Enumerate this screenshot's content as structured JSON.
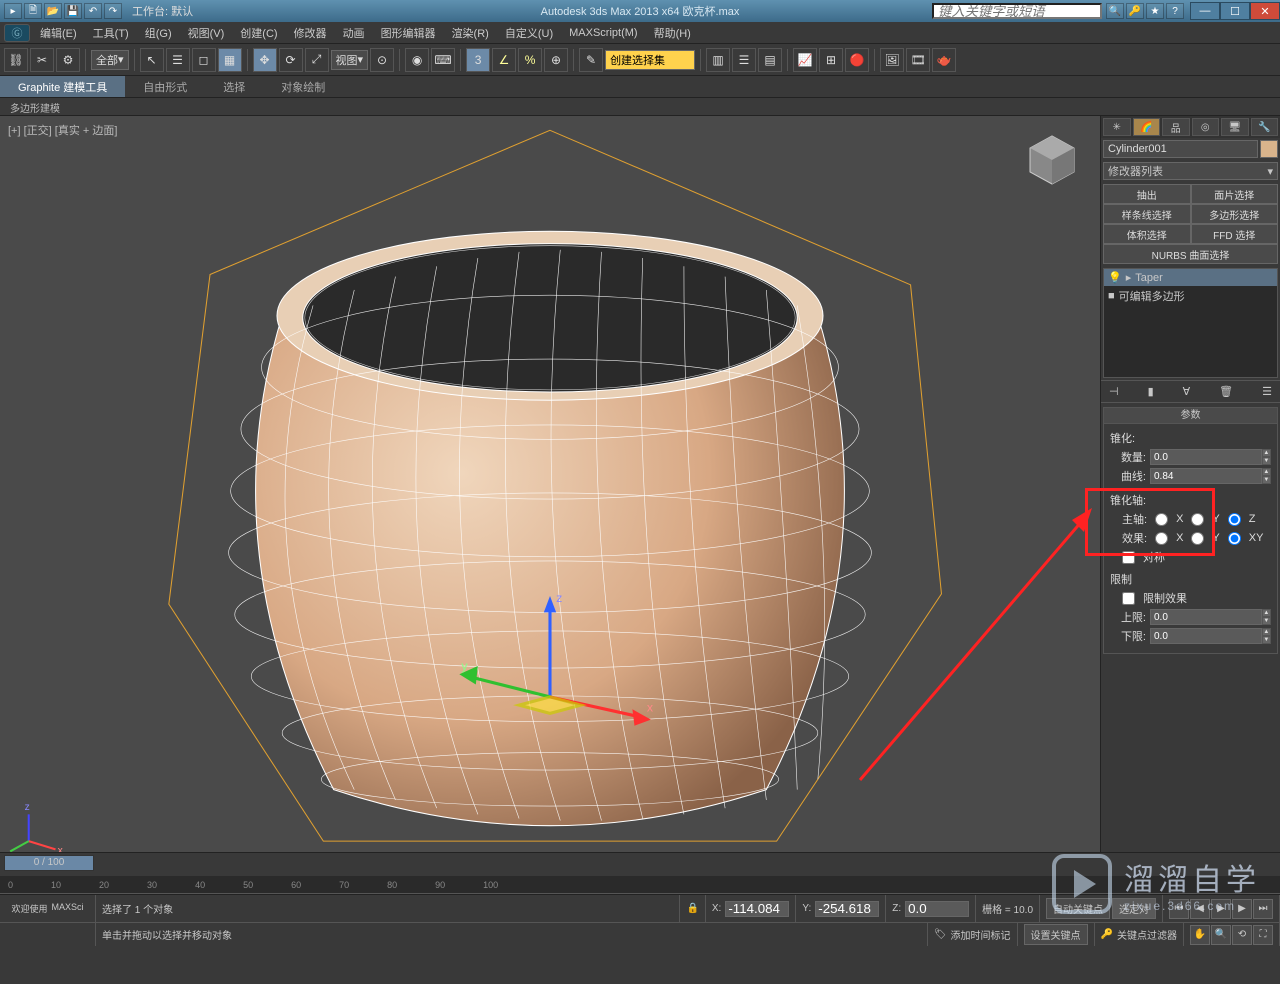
{
  "titlebar": {
    "workspace_label": "工作台: 默认",
    "app_title": "Autodesk 3ds Max  2013 x64   欧克杯.max",
    "search_placeholder": "键入关键字或短语"
  },
  "menus": [
    "编辑(E)",
    "工具(T)",
    "组(G)",
    "视图(V)",
    "创建(C)",
    "修改器",
    "动画",
    "图形编辑器",
    "渲染(R)",
    "自定义(U)",
    "MAXScript(M)",
    "帮助(H)"
  ],
  "toolbar": {
    "all_dropdown": "全部",
    "view_dropdown": "视图",
    "selset_placeholder": "创建选择集"
  },
  "ribbon": {
    "tabs": [
      "Graphite 建模工具",
      "自由形式",
      "选择",
      "对象绘制"
    ],
    "sub": "多边形建模"
  },
  "viewport": {
    "label": "[+] [正交] [真实 + 边面]"
  },
  "sidepanel": {
    "object_name": "Cylinder001",
    "modlist_label": "修改器列表",
    "mod_buttons": [
      "抽出",
      "面片选择",
      "样条线选择",
      "多边形选择",
      "体积选择",
      "FFD 选择"
    ],
    "nurbs_label": "NURBS 曲面选择",
    "stack": [
      {
        "icon": "💡",
        "name": "Taper",
        "sel": true
      },
      {
        "icon": "■",
        "name": "可编辑多边形",
        "sel": false
      }
    ],
    "params": {
      "header": "参数",
      "taper_label": "锥化:",
      "amount_label": "数量:",
      "amount_value": "0.0",
      "curve_label": "曲线:",
      "curve_value": "0.84",
      "axis_label": "锥化轴:",
      "mainaxis_label": "主轴:",
      "effect_label": "效果:",
      "axes": [
        "X",
        "Y",
        "Z"
      ],
      "effects": [
        "X",
        "Y",
        "XY"
      ],
      "symmetric_label": "对称",
      "limit_label": "限制",
      "limit_effect_label": "限制效果",
      "upper_label": "上限:",
      "upper_value": "0.0",
      "lower_label": "下限:",
      "lower_value": "0.0"
    }
  },
  "timeline": {
    "pos": "0 / 100"
  },
  "status": {
    "welcome": "欢迎使用",
    "maxs": "MAXSci",
    "sel_text": "选择了 1 个对象",
    "hint": "单击并拖动以选择并移动对象",
    "x": "-114.084",
    "y": "-254.618",
    "z": "0.0",
    "grid_label": "栅格 = 10.0",
    "autokey": "自动关键点",
    "setkey": "设置关键点",
    "timetag": "添加时间标记",
    "seldrop": "选定对",
    "keyfilter": "关键点过滤器"
  },
  "watermark": {
    "brand": "溜溜自学",
    "url": "zixue.3d66.com"
  }
}
